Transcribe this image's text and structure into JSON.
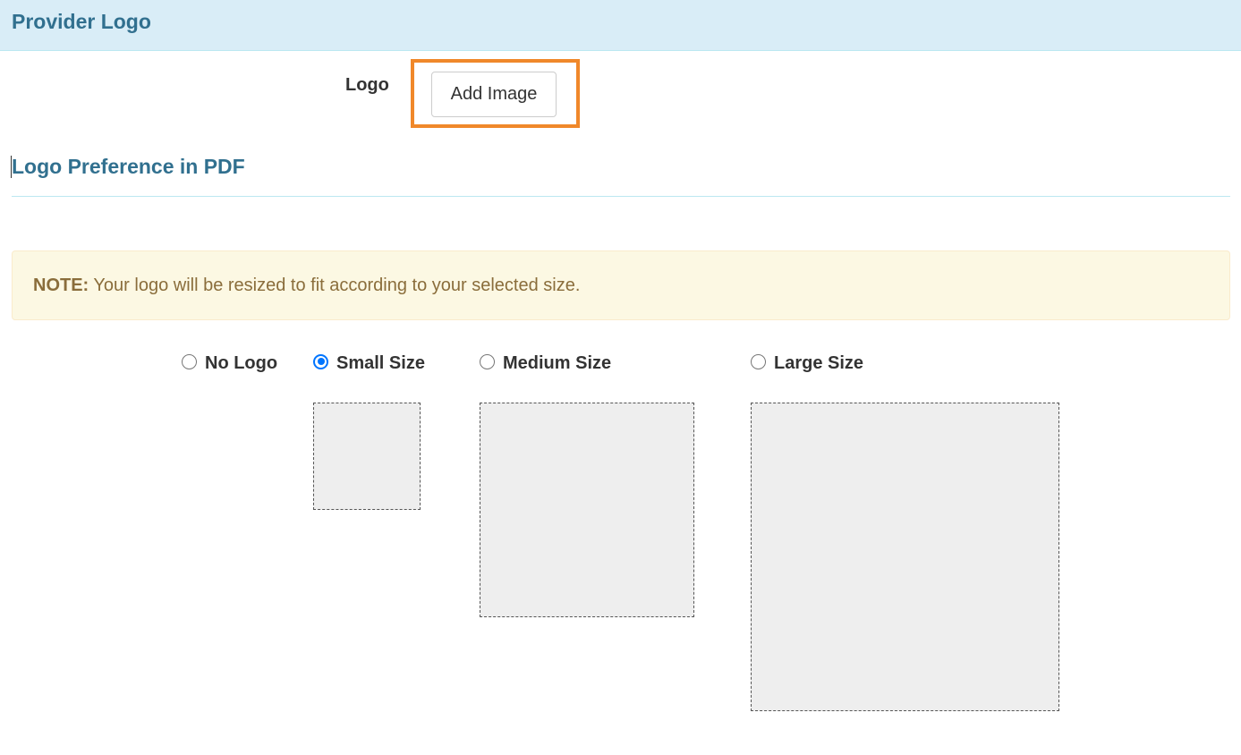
{
  "header": {
    "title": "Provider Logo"
  },
  "logo": {
    "label": "Logo",
    "add_image_label": "Add Image"
  },
  "preference": {
    "title": "Logo Preference in PDF"
  },
  "note": {
    "label": "NOTE:",
    "text": " Your logo will be resized to fit according to your selected size."
  },
  "size_options": [
    {
      "label": "No Logo",
      "selected": false
    },
    {
      "label": "Small Size",
      "selected": true
    },
    {
      "label": "Medium Size",
      "selected": false
    },
    {
      "label": "Large Size",
      "selected": false
    }
  ],
  "colors": {
    "header_bg": "#d9edf7",
    "heading_text": "#31708f",
    "note_bg": "#fcf8e3",
    "note_text": "#8a6d3b",
    "highlight": "#f0882a",
    "radio_accent": "#0075ff"
  }
}
